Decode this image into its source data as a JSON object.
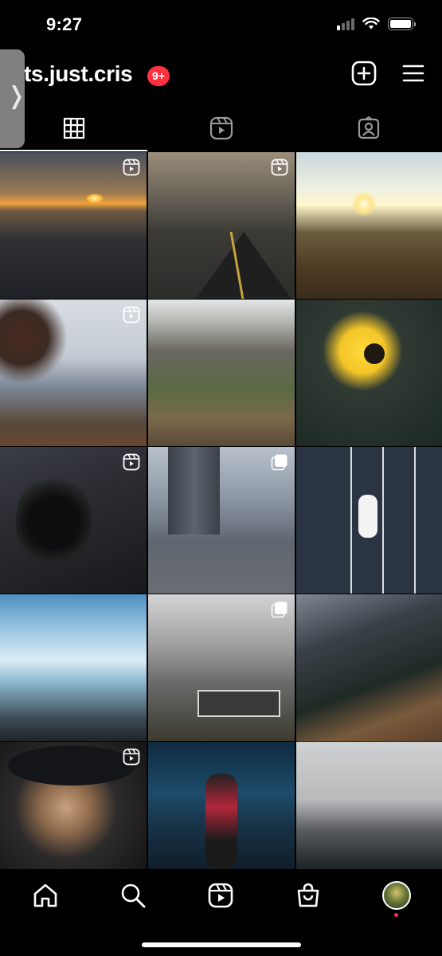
{
  "status_bar": {
    "time": "9:27"
  },
  "header": {
    "username": "ts.just.cris",
    "notification_count": "9+"
  },
  "tabs": [
    {
      "name": "posts-grid",
      "icon": "grid-icon",
      "active": true
    },
    {
      "name": "reels",
      "icon": "reels-icon",
      "active": false
    },
    {
      "name": "tagged",
      "icon": "tagged-icon",
      "active": false
    }
  ],
  "grid": {
    "posts": [
      {
        "subject": "sunset over valley city lights",
        "type": "reel"
      },
      {
        "subject": "road at dusk with trees",
        "type": "reel"
      },
      {
        "subject": "sun over lake with car",
        "type": "post"
      },
      {
        "subject": "snowy mountains behind branches",
        "type": "reel"
      },
      {
        "subject": "rocky hill landscape",
        "type": "post"
      },
      {
        "subject": "yellow sunflower",
        "type": "post"
      },
      {
        "subject": "car wheel close-up",
        "type": "reel"
      },
      {
        "subject": "city skyscrapers from parking garage",
        "type": "carousel"
      },
      {
        "subject": "aerial view of car in parking lot",
        "type": "post"
      },
      {
        "subject": "person on icy lake shore",
        "type": "post"
      },
      {
        "subject": "person on abandoned bus under clouds",
        "type": "carousel"
      },
      {
        "subject": "aerial mountain canyon road",
        "type": "post"
      },
      {
        "subject": "bearded man in hat portrait",
        "type": "reel"
      },
      {
        "subject": "man in red jacket with city lights",
        "type": "post"
      },
      {
        "subject": "misty snowy mountains",
        "type": "post"
      }
    ]
  },
  "bottom_nav": [
    {
      "name": "home",
      "icon": "home-icon"
    },
    {
      "name": "search",
      "icon": "search-icon"
    },
    {
      "name": "reels",
      "icon": "reels-icon"
    },
    {
      "name": "shop",
      "icon": "shopping-bag-icon"
    },
    {
      "name": "profile",
      "icon": "avatar"
    }
  ],
  "colors": {
    "background": "#000000",
    "badge": "#ff3040",
    "text": "#ffffff"
  }
}
